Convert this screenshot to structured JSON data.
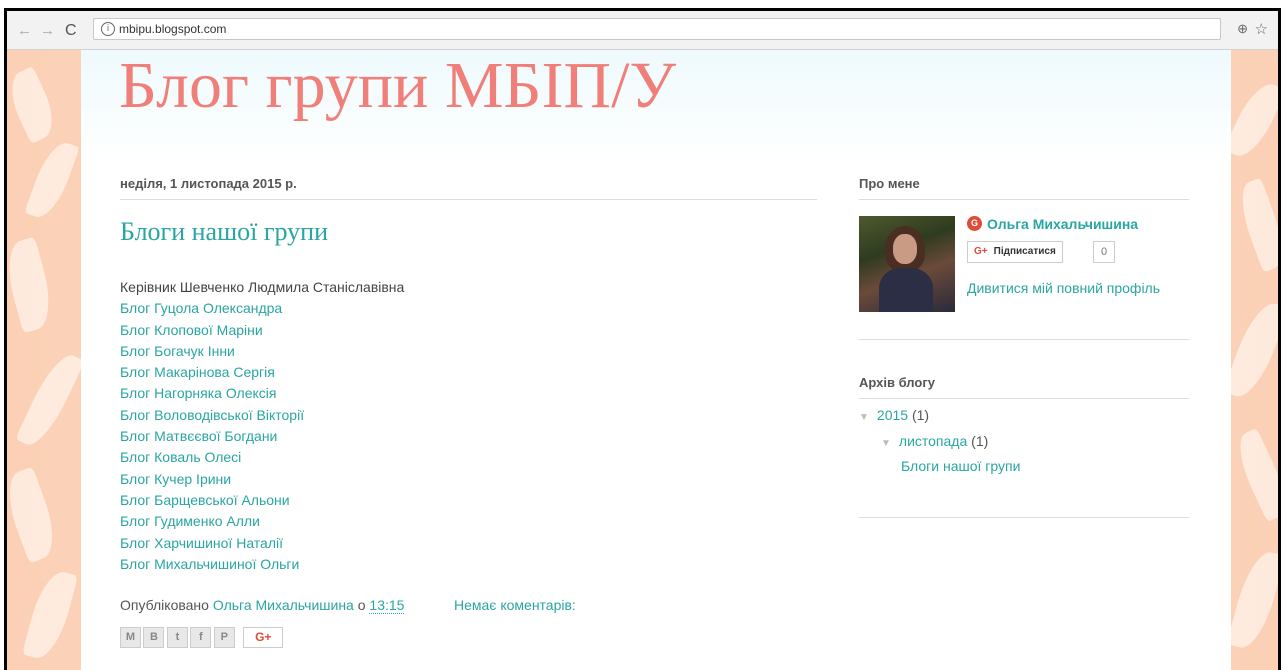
{
  "browser": {
    "url": "mbipu.blogspot.com",
    "back_icon": "←",
    "forward_icon": "→",
    "reload_icon": "C",
    "info_icon": "i",
    "zoom_icon": "⊕",
    "star_icon": "☆"
  },
  "blog": {
    "title": "Блог групи МБІП/У"
  },
  "post": {
    "date": "неділя, 1 листопада 2015 р.",
    "title": "Блоги нашої групи",
    "leader": "Керівник Шевченко Людмила Станіславівна",
    "links": [
      "Блог Гуцола Олександра",
      "Блог Клопової Маріни",
      "Блог Богачук Інни",
      "Блог Макарінова Сергія",
      "Блог Нагорняка Олексія",
      "Блог Воловодівської Вікторії",
      "Блог Матвєєвої Богдани",
      "Блог Коваль Олесі",
      "Блог Кучер Ірини",
      "Блог Барщевської Альони",
      "Блог Гудименко Алли",
      "Блог Харчишиної Наталії",
      "Блог Михальчишиної Ольги"
    ],
    "footer": {
      "published": "Опубліковано",
      "author": "Ольга Михальчишина",
      "at": "о",
      "time": "13:15",
      "comments": "Немає коментарів:"
    },
    "share": {
      "email": "M",
      "blog": "B",
      "twitter": "t",
      "facebook": "f",
      "pinterest": "P",
      "gplus": "G+"
    }
  },
  "sidebar": {
    "about_heading": "Про мене",
    "profile_name": "Ольга Михальчишина",
    "gplus_icon": "G",
    "follow_label": "Підписатися",
    "follow_g": "G+",
    "follower_count": "0",
    "profile_link": "Дивитися мій повний профіль",
    "archive_heading": "Архів блогу",
    "archive": {
      "year": "2015",
      "year_count": "(1)",
      "month": "листопада",
      "month_count": "(1)",
      "post": "Блоги нашої групи",
      "toggle_icon": "▼"
    }
  },
  "colors": {
    "accent": "#2aa6a2",
    "title": "#f07f7a",
    "background": "#fbd0b5"
  }
}
